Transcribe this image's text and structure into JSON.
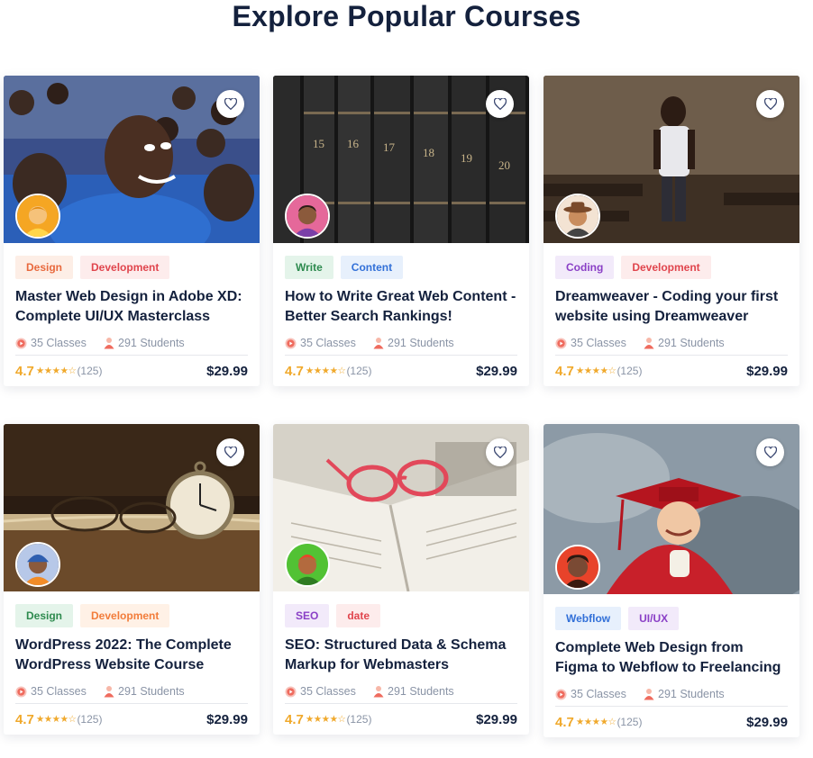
{
  "page": {
    "title": "Explore Popular Courses"
  },
  "courses": [
    {
      "tags": [
        {
          "label": "Design",
          "cls": "t-design"
        },
        {
          "label": "Development",
          "cls": "t-dev"
        }
      ],
      "title": "Master Web Design in Adobe XD: Complete UI/UX Masterclass",
      "classes": "35 Classes",
      "students": "291 Students",
      "rating": "4.7",
      "stars": "★★★★☆",
      "reviews": "(125)",
      "price": "$29.99",
      "image": "school-children-photo",
      "avatar": "instructor-avatar-yellow"
    },
    {
      "tags": [
        {
          "label": "Write",
          "cls": "t-write"
        },
        {
          "label": "Content",
          "cls": "t-content"
        }
      ],
      "title": "How to Write Great Web Content - Better Search Rankings!",
      "classes": "35 Classes",
      "students": "291 Students",
      "rating": "4.7",
      "stars": "★★★★☆",
      "reviews": "(125)",
      "price": "$29.99",
      "image": "book-spines-photo",
      "avatar": "instructor-avatar-pink"
    },
    {
      "tags": [
        {
          "label": "Coding",
          "cls": "t-coding"
        },
        {
          "label": "Development",
          "cls": "t-dev"
        }
      ],
      "title": "Dreamweaver - Coding your first website using Dreamweaver",
      "classes": "35 Classes",
      "students": "291 Students",
      "rating": "4.7",
      "stars": "★★★★☆",
      "reviews": "(125)",
      "price": "$29.99",
      "image": "classroom-boy-photo",
      "avatar": "instructor-avatar-hat"
    },
    {
      "tags": [
        {
          "label": "Design",
          "cls": "t-design2"
        },
        {
          "label": "Development",
          "cls": "t-dev2"
        }
      ],
      "title": "WordPress 2022: The Complete WordPress Website Course",
      "classes": "35 Classes",
      "students": "291 Students",
      "rating": "4.7",
      "stars": "★★★★☆",
      "reviews": "(125)",
      "price": "$29.99",
      "image": "pocket-watch-photo",
      "avatar": "instructor-avatar-blue"
    },
    {
      "tags": [
        {
          "label": "SEO",
          "cls": "t-seo"
        },
        {
          "label": "date",
          "cls": "t-date"
        }
      ],
      "title": "SEO: Structured Data & Schema Markup for Webmasters",
      "classes": "35 Classes",
      "students": "291 Students",
      "rating": "4.7",
      "stars": "★★★★☆",
      "reviews": "(125)",
      "price": "$29.99",
      "image": "glasses-on-book-photo",
      "avatar": "instructor-avatar-green"
    },
    {
      "tags": [
        {
          "label": "Webflow",
          "cls": "t-webflow"
        },
        {
          "label": "UI/UX",
          "cls": "t-uiux"
        }
      ],
      "title": "Complete Web Design from Figma to Webflow to Freelancing",
      "classes": "35 Classes",
      "students": "291 Students",
      "rating": "4.7",
      "stars": "★★★★☆",
      "reviews": "(125)",
      "price": "$29.99",
      "image": "graduate-boy-photo",
      "avatar": "instructor-avatar-red"
    }
  ]
}
